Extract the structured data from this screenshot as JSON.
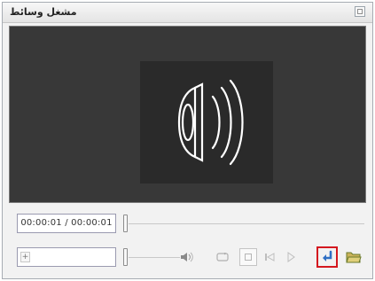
{
  "window": {
    "title": "مشغل وسائط"
  },
  "player": {
    "time_display": "00:00:01 / 00:00:01",
    "spin_symbol": "+"
  },
  "icons": {
    "close": "close-icon",
    "speaker": "speaker-sound-icon",
    "volume": "volume-icon",
    "loop": "loop-icon",
    "stop": "stop-icon",
    "previous": "previous-icon",
    "play": "play-icon",
    "insert": "insert-return-icon",
    "open_folder": "folder-open-icon"
  },
  "colors": {
    "highlight": "#d4181f",
    "insert_icon": "#2f6fc4",
    "folder_icon": "#6a7a2a",
    "video_bg": "#383838"
  }
}
